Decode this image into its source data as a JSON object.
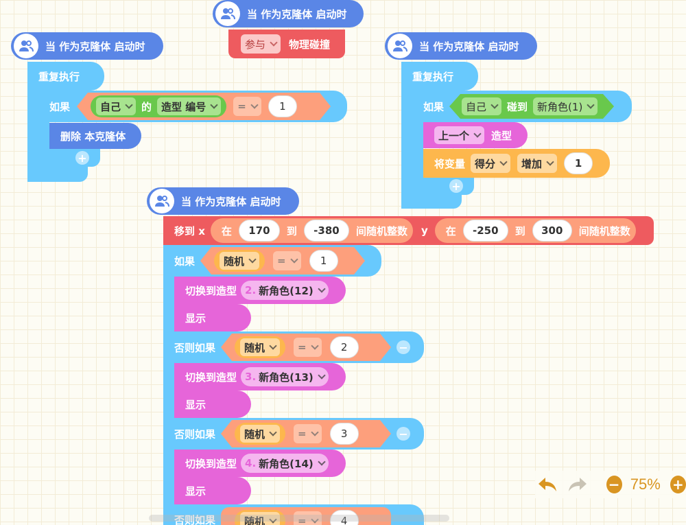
{
  "hat_label": "当 作为克隆体 启动时",
  "block1": {
    "repeat": "重复执行",
    "if": "如果",
    "self": "自己",
    "of": "的",
    "costume_no": "造型 编号",
    "eq": "=",
    "val": "1",
    "delete": "删除 本克隆体"
  },
  "block2": {
    "join": "参与",
    "physics": "物理碰撞"
  },
  "block3": {
    "repeat": "重复执行",
    "if": "如果",
    "self": "自己",
    "touch": "碰到",
    "target": "新角色(1)",
    "prev": "上一个",
    "costume": "造型",
    "setvar": "将变量",
    "var": "得分",
    "op": "增加",
    "val": "1"
  },
  "block4": {
    "move": "移到 x",
    "in": "在",
    "x_from": "170",
    "to": "到",
    "x_to": "-380",
    "rand_int": "间随机整数",
    "y": "y",
    "y_from": "-250",
    "y_to": "300",
    "if": "如果",
    "elif": "否则如果",
    "rand": "随机",
    "eq": "=",
    "switch": "切换到造型",
    "show": "显示",
    "branches": [
      {
        "val": "1",
        "idx": "2.",
        "costume": "新角色(12)"
      },
      {
        "val": "2",
        "idx": "3.",
        "costume": "新角色(13)"
      },
      {
        "val": "3",
        "idx": "4.",
        "costume": "新角色(14)"
      },
      {
        "val": "4"
      }
    ]
  },
  "toolbar": {
    "zoom": "75%"
  }
}
